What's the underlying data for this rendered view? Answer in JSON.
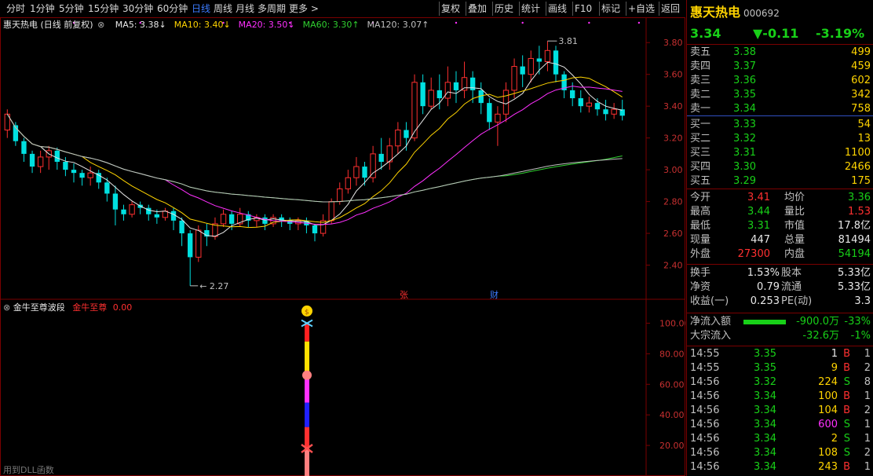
{
  "toolbar": {
    "periods": [
      "分时",
      "1分钟",
      "5分钟",
      "15分钟",
      "30分钟",
      "60分钟",
      "日线",
      "周线",
      "月线",
      "多周期",
      "更多 >"
    ],
    "active_period": "日线",
    "actions": [
      "复权",
      "叠加",
      "历史",
      "统计",
      "画线",
      "F10",
      "标记",
      "+自选",
      "返回"
    ]
  },
  "legend": {
    "title": "惠天热电 (日线 前复权)",
    "ma": [
      {
        "label": "MA5: 3.38↓",
        "color": "#e8e8e8"
      },
      {
        "label": "MA10: 3.40↓",
        "color": "#ffd400"
      },
      {
        "label": "MA20: 3.50↓",
        "color": "#ff30ff"
      },
      {
        "label": "MA60: 3.30↑",
        "color": "#30d030"
      },
      {
        "label": "MA120: 3.07↑",
        "color": "#c0c0c0"
      }
    ]
  },
  "price_axis": [
    "3.80",
    "3.60",
    "3.40",
    "3.20",
    "3.00",
    "2.80",
    "2.60",
    "2.40"
  ],
  "annotations": {
    "high": "3.81",
    "low": "2.27",
    "event1": "张",
    "event2": "财"
  },
  "sub_chart": {
    "title": "金牛至尊波段",
    "indicator": "金牛至尊",
    "value": "0.00",
    "axis": [
      "100.00",
      "80.00",
      "60.00",
      "40.00",
      "20.00"
    ],
    "hint": "用到DLL函数"
  },
  "chart_data": {
    "type": "candlestick",
    "ylim": [
      2.27,
      3.81
    ],
    "candles": [
      [
        3.25,
        3.35,
        3.2,
        3.38
      ],
      [
        3.28,
        3.18,
        3.15,
        3.3
      ],
      [
        3.18,
        3.1,
        3.05,
        3.2
      ],
      [
        3.1,
        3.02,
        2.98,
        3.12
      ],
      [
        3.02,
        3.08,
        2.98,
        3.12
      ],
      [
        3.08,
        3.12,
        3.0,
        3.15
      ],
      [
        3.12,
        3.05,
        3.0,
        3.14
      ],
      [
        3.05,
        3.0,
        2.96,
        3.08
      ],
      [
        3.0,
        2.98,
        2.92,
        3.04
      ],
      [
        2.98,
        2.95,
        2.9,
        3.0
      ],
      [
        2.95,
        2.98,
        2.9,
        3.02
      ],
      [
        2.98,
        2.92,
        2.88,
        3.0
      ],
      [
        2.92,
        2.85,
        2.8,
        2.95
      ],
      [
        2.85,
        2.75,
        2.65,
        2.9
      ],
      [
        2.75,
        2.72,
        2.68,
        2.78
      ],
      [
        2.72,
        2.78,
        2.7,
        2.8
      ],
      [
        2.78,
        2.76,
        2.72,
        2.8
      ],
      [
        2.76,
        2.72,
        2.68,
        2.78
      ],
      [
        2.72,
        2.7,
        2.66,
        2.75
      ],
      [
        2.7,
        2.74,
        2.68,
        2.76
      ],
      [
        2.74,
        2.68,
        2.62,
        2.76
      ],
      [
        2.68,
        2.6,
        2.52,
        2.7
      ],
      [
        2.6,
        2.45,
        2.27,
        2.62
      ],
      [
        2.45,
        2.62,
        2.42,
        2.65
      ],
      [
        2.62,
        2.58,
        2.52,
        2.66
      ],
      [
        2.58,
        2.66,
        2.56,
        2.7
      ],
      [
        2.66,
        2.72,
        2.64,
        2.75
      ],
      [
        2.72,
        2.66,
        2.62,
        2.74
      ],
      [
        2.66,
        2.72,
        2.64,
        2.76
      ],
      [
        2.72,
        2.68,
        2.64,
        2.74
      ],
      [
        2.68,
        2.7,
        2.64,
        2.72
      ],
      [
        2.7,
        2.66,
        2.62,
        2.72
      ],
      [
        2.66,
        2.7,
        2.64,
        2.72
      ],
      [
        2.7,
        2.68,
        2.64,
        2.72
      ],
      [
        2.68,
        2.66,
        2.62,
        2.7
      ],
      [
        2.66,
        2.68,
        2.62,
        2.7
      ],
      [
        2.68,
        2.65,
        2.6,
        2.7
      ],
      [
        2.65,
        2.6,
        2.55,
        2.66
      ],
      [
        2.6,
        2.68,
        2.58,
        2.72
      ],
      [
        2.68,
        2.8,
        2.66,
        2.82
      ],
      [
        2.8,
        2.88,
        2.78,
        2.92
      ],
      [
        2.88,
        2.95,
        2.85,
        3.0
      ],
      [
        2.95,
        3.02,
        2.9,
        3.08
      ],
      [
        3.02,
        2.95,
        2.9,
        3.05
      ],
      [
        2.95,
        3.1,
        2.92,
        3.15
      ],
      [
        3.1,
        3.05,
        3.0,
        3.2
      ],
      [
        3.05,
        3.15,
        3.0,
        3.2
      ],
      [
        3.15,
        3.25,
        3.1,
        3.3
      ],
      [
        3.25,
        3.2,
        3.12,
        3.3
      ],
      [
        3.2,
        3.55,
        3.18,
        3.6
      ],
      [
        3.55,
        3.4,
        3.35,
        3.6
      ],
      [
        3.4,
        3.5,
        3.38,
        3.58
      ],
      [
        3.5,
        3.45,
        3.38,
        3.6
      ],
      [
        3.45,
        3.55,
        3.4,
        3.65
      ],
      [
        3.55,
        3.5,
        3.42,
        3.62
      ],
      [
        3.5,
        3.58,
        3.45,
        3.68
      ],
      [
        3.58,
        3.5,
        3.42,
        3.62
      ],
      [
        3.5,
        3.42,
        3.35,
        3.55
      ],
      [
        3.42,
        3.3,
        3.25,
        3.45
      ],
      [
        3.3,
        3.35,
        3.15,
        3.4
      ],
      [
        3.35,
        3.5,
        3.3,
        3.55
      ],
      [
        3.5,
        3.65,
        3.45,
        3.7
      ],
      [
        3.65,
        3.6,
        3.52,
        3.72
      ],
      [
        3.6,
        3.7,
        3.55,
        3.75
      ],
      [
        3.7,
        3.68,
        3.6,
        3.78
      ],
      [
        3.68,
        3.75,
        3.62,
        3.81
      ],
      [
        3.75,
        3.6,
        3.55,
        3.78
      ],
      [
        3.6,
        3.5,
        3.45,
        3.62
      ],
      [
        3.5,
        3.45,
        3.4,
        3.55
      ],
      [
        3.45,
        3.4,
        3.36,
        3.5
      ],
      [
        3.4,
        3.42,
        3.36,
        3.46
      ],
      [
        3.42,
        3.38,
        3.34,
        3.45
      ],
      [
        3.38,
        3.35,
        3.31,
        3.44
      ],
      [
        3.35,
        3.38,
        3.32,
        3.42
      ],
      [
        3.38,
        3.34,
        3.31,
        3.44
      ]
    ],
    "series": [
      {
        "name": "MA5",
        "color": "#e8e8e8"
      },
      {
        "name": "MA10",
        "color": "#ffd400"
      },
      {
        "name": "MA20",
        "color": "#ff30ff"
      },
      {
        "name": "MA60",
        "color": "#30d030"
      },
      {
        "name": "MA120",
        "color": "#c0c0c0"
      }
    ]
  },
  "quote": {
    "name": "惠天热电",
    "code": "000692",
    "price": "3.34",
    "change": "▼-0.11",
    "pct": "-3.19%",
    "asks": [
      {
        "label": "卖五",
        "price": "3.38",
        "vol": "499"
      },
      {
        "label": "卖四",
        "price": "3.37",
        "vol": "459"
      },
      {
        "label": "卖三",
        "price": "3.36",
        "vol": "602"
      },
      {
        "label": "卖二",
        "price": "3.35",
        "vol": "342"
      },
      {
        "label": "卖一",
        "price": "3.34",
        "vol": "758"
      }
    ],
    "bids": [
      {
        "label": "买一",
        "price": "3.33",
        "vol": "54"
      },
      {
        "label": "买二",
        "price": "3.32",
        "vol": "13"
      },
      {
        "label": "买三",
        "price": "3.31",
        "vol": "1100"
      },
      {
        "label": "买四",
        "price": "3.30",
        "vol": "2466"
      },
      {
        "label": "买五",
        "price": "3.29",
        "vol": "175"
      }
    ],
    "stats": [
      {
        "l1": "今开",
        "v1": "3.41",
        "c1": "red",
        "l2": "均价",
        "v2": "3.36",
        "c2": "green"
      },
      {
        "l1": "最高",
        "v1": "3.44",
        "c1": "green",
        "l2": "量比",
        "v2": "1.53",
        "c2": "red"
      },
      {
        "l1": "最低",
        "v1": "3.31",
        "c1": "green",
        "l2": "市值",
        "v2": "17.8亿",
        "c2": "white"
      },
      {
        "l1": "现量",
        "v1": "447",
        "c1": "white",
        "l2": "总量",
        "v2": "81494",
        "c2": "white"
      },
      {
        "l1": "外盘",
        "v1": "27300",
        "c1": "red",
        "l2": "内盘",
        "v2": "54194",
        "c2": "green"
      }
    ],
    "fundamentals": [
      {
        "l1": "换手",
        "v1": "1.53%",
        "l2": "股本",
        "v2": "5.33亿"
      },
      {
        "l1": "净资",
        "v1": "0.79",
        "l2": "流通",
        "v2": "5.33亿"
      },
      {
        "l1": "收益(一)",
        "v1": "0.253",
        "l2": "PE(动)",
        "v2": "3.3"
      }
    ],
    "flow": [
      {
        "label": "净流入额",
        "value": "-900.0万",
        "pct": "-33%"
      },
      {
        "label": "大宗流入",
        "value": "-32.6万",
        "pct": "-1%"
      }
    ],
    "ticks": [
      {
        "time": "14:55",
        "price": "3.35",
        "vol": "1",
        "side": "B",
        "n": "1",
        "vc": "white"
      },
      {
        "time": "14:55",
        "price": "3.35",
        "vol": "9",
        "side": "B",
        "n": "2",
        "vc": "yellow"
      },
      {
        "time": "14:56",
        "price": "3.32",
        "vol": "224",
        "side": "S",
        "n": "8",
        "vc": "yellow"
      },
      {
        "time": "14:56",
        "price": "3.34",
        "vol": "100",
        "side": "B",
        "n": "1",
        "vc": "yellow"
      },
      {
        "time": "14:56",
        "price": "3.34",
        "vol": "104",
        "side": "B",
        "n": "2",
        "vc": "yellow"
      },
      {
        "time": "14:56",
        "price": "3.34",
        "vol": "600",
        "side": "S",
        "n": "1",
        "vc": "magenta"
      },
      {
        "time": "14:56",
        "price": "3.34",
        "vol": "2",
        "side": "S",
        "n": "1",
        "vc": "yellow"
      },
      {
        "time": "14:56",
        "price": "3.34",
        "vol": "108",
        "side": "S",
        "n": "2",
        "vc": "yellow"
      },
      {
        "time": "14:56",
        "price": "3.34",
        "vol": "243",
        "side": "B",
        "n": "1",
        "vc": "yellow"
      }
    ]
  }
}
